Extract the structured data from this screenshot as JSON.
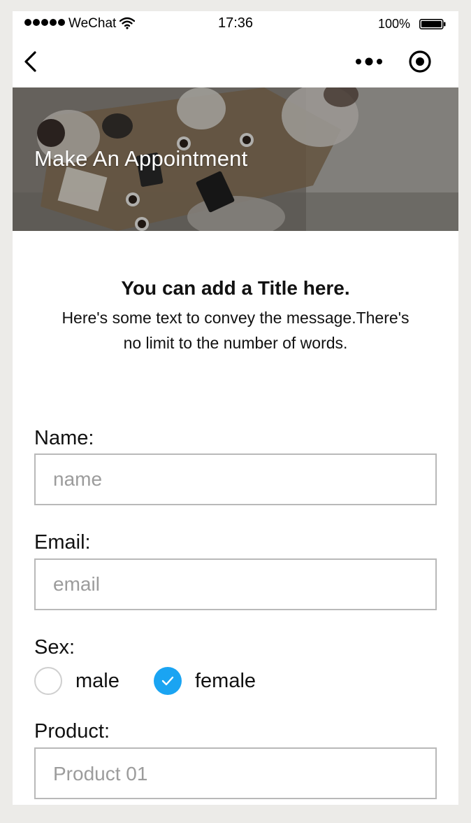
{
  "status_bar": {
    "carrier": "WeChat",
    "time": "17:36",
    "battery": "100%"
  },
  "banner": {
    "title": "Make An Appointment"
  },
  "intro": {
    "title": "You can add a Title here.",
    "text": "Here's some text to convey the message.There's no limit to the number of words."
  },
  "form": {
    "name": {
      "label": "Name:",
      "placeholder": "name",
      "value": ""
    },
    "email": {
      "label": "Email:",
      "placeholder": "email",
      "value": ""
    },
    "sex": {
      "label": "Sex:",
      "options": [
        {
          "label": "male",
          "checked": false
        },
        {
          "label": "female",
          "checked": true
        }
      ]
    },
    "product": {
      "label": "Product:",
      "selected": "Product 01"
    }
  },
  "colors": {
    "accent": "#1aa4f2",
    "input_border": "#b9b9b9",
    "placeholder": "#9c9c9c",
    "background": "#ecebe8"
  },
  "icons": {
    "back": "back-arrow-icon",
    "more": "more-dots-icon",
    "close_target": "target-icon",
    "wifi": "wifi-icon",
    "battery": "battery-icon",
    "check": "check-icon"
  }
}
